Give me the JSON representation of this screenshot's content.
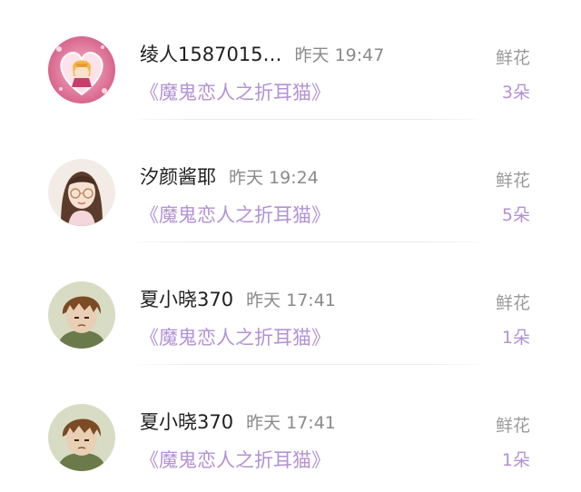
{
  "gift_list": [
    {
      "name": "绫人1587015…",
      "time": "昨天 19:47",
      "book": "《魔鬼恋人之折耳猫》",
      "gift_label": "鲜花",
      "gift_count": "3朵",
      "avatar": "pink-heart-anime-avatar"
    },
    {
      "name": "汐颜酱耶",
      "time": "昨天 19:24",
      "book": "《魔鬼恋人之折耳猫》",
      "gift_label": "鲜花",
      "gift_count": "5朵",
      "avatar": "girl-with-glasses-avatar"
    },
    {
      "name": "夏小晓370",
      "time": "昨天 17:41",
      "book": "《魔鬼恋人之折耳猫》",
      "gift_label": "鲜花",
      "gift_count": "1朵",
      "avatar": "brown-hair-boy-avatar"
    },
    {
      "name": "夏小晓370",
      "time": "昨天 17:41",
      "book": "《魔鬼恋人之折耳猫》",
      "gift_label": "鲜花",
      "gift_count": "1朵",
      "avatar": "brown-hair-boy-avatar"
    }
  ],
  "colors": {
    "accent": "#b292d4",
    "name": "#1f1f1f",
    "muted": "#8a8a8a"
  }
}
